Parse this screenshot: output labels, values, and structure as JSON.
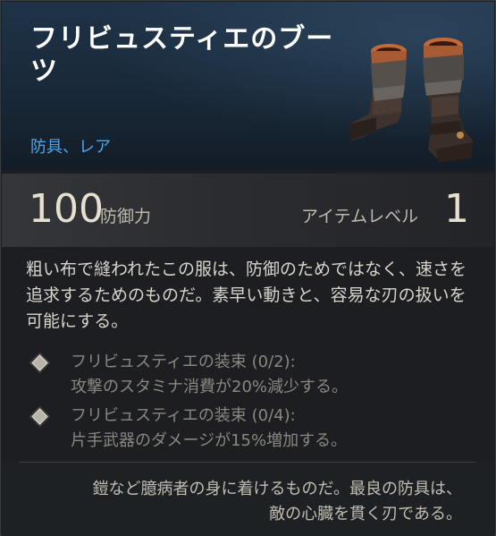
{
  "item": {
    "name": "フリビュスティエのブーツ",
    "type": "防具、レア",
    "image_icon": "leather-boots-icon"
  },
  "stats": {
    "defense_value": "100",
    "defense_label": "防御力",
    "level_label": "アイテムレベル",
    "level_value": "1"
  },
  "description": "粗い布で縫われたこの服は、防御のためではなく、速さを追求するためのものだ。素早い動きと、容易な刃の扱いを可能にする。",
  "set_bonuses": [
    {
      "title": "フリビュスティエの装束 (0/2):",
      "effect": "攻撃のスタミナ消費が20%減少する。",
      "icon": "diamond-bullet-icon"
    },
    {
      "title": "フリビュスティエの装束 (0/4):",
      "effect": "片手武器のダメージが15%増加する。",
      "icon": "diamond-bullet-icon"
    }
  ],
  "flavor_lines": [
    "鎧など臆病者の身に着けるものだ。最良の防具は、",
    "敵の心臓を貫く刃である。"
  ],
  "colors": {
    "rarity": "#4fa6e8",
    "name": "#ffffff",
    "header_bg": "#1f3347",
    "text": "#d8d4cc",
    "inactive_set": "#8a8780"
  }
}
